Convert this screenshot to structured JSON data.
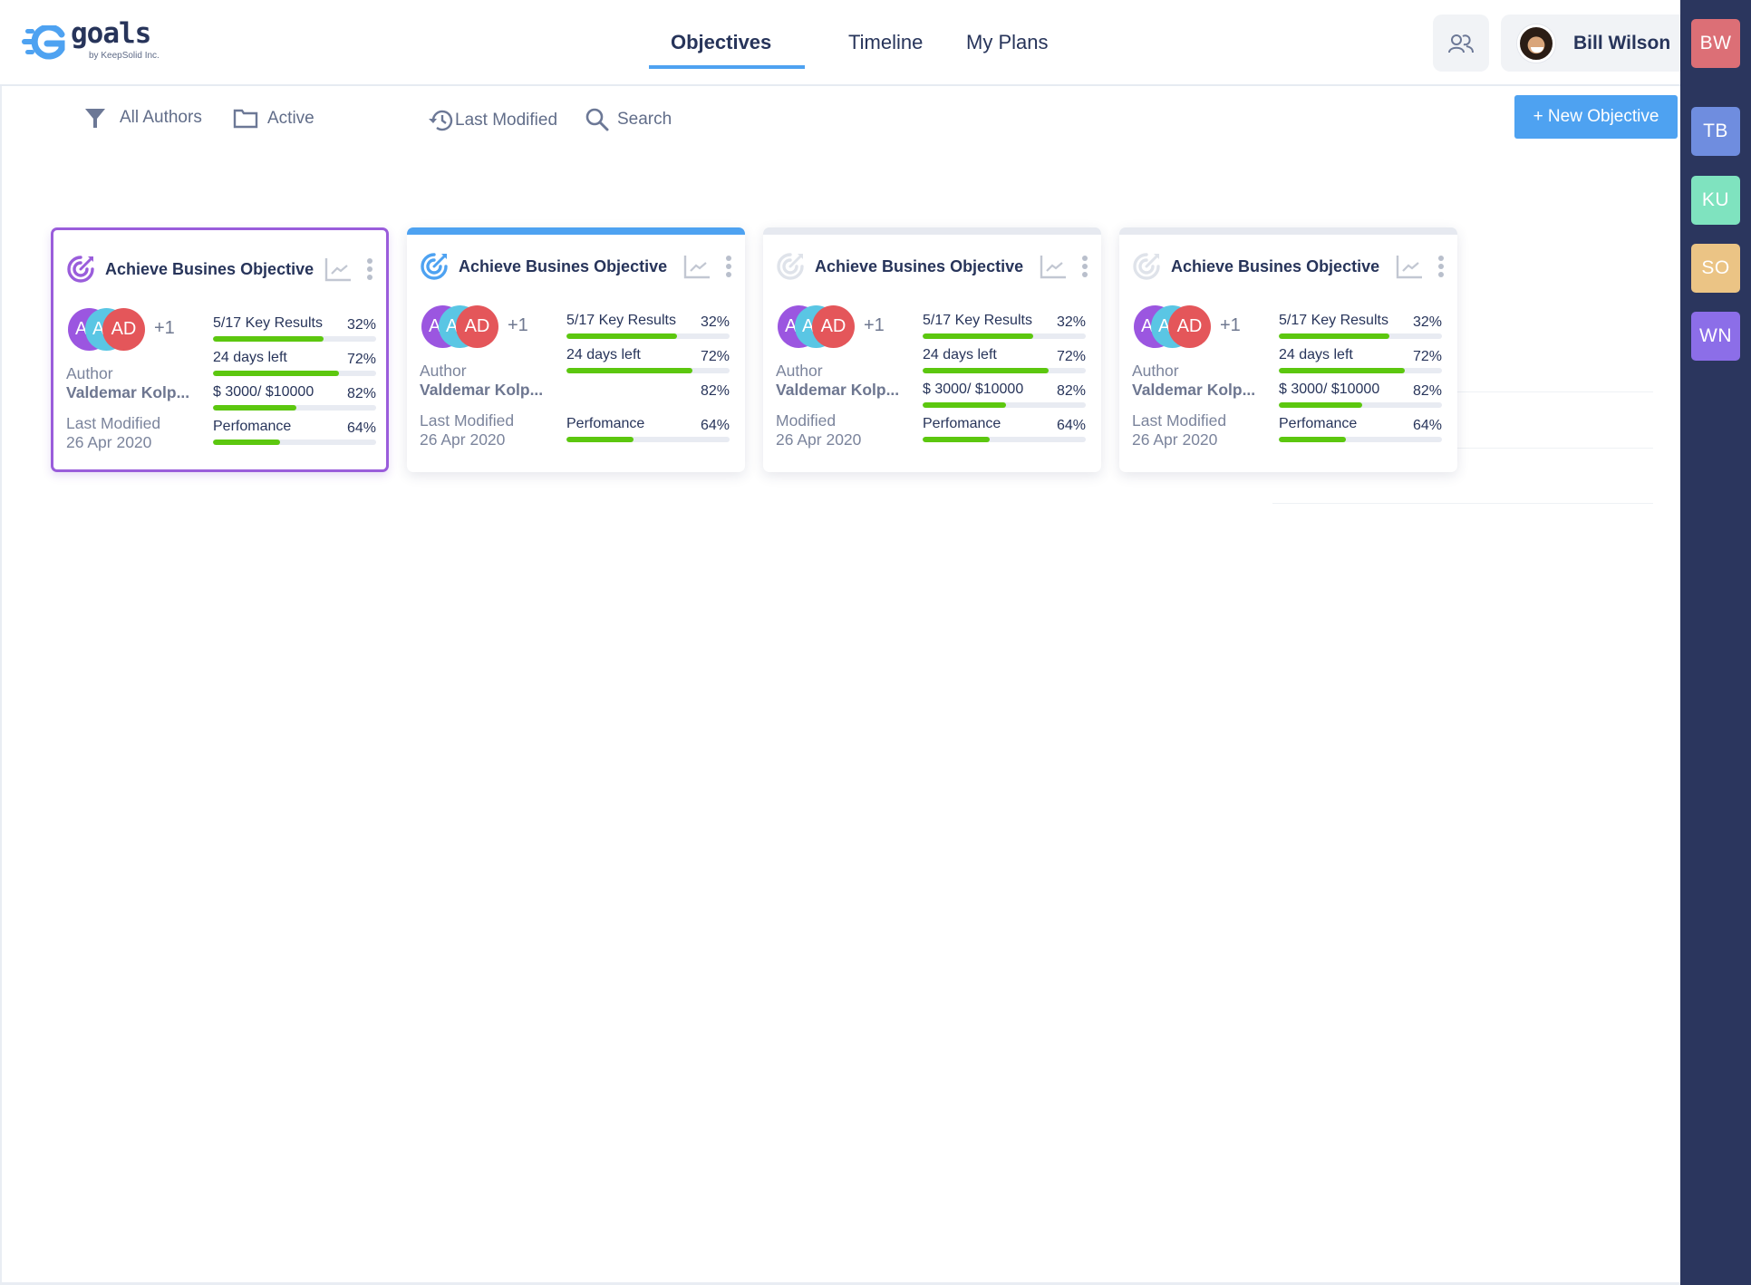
{
  "app": {
    "logo_text": "goals",
    "logo_subtitle": "by KeepSolid Inc.",
    "brand_color": "#4ea2f1"
  },
  "nav": {
    "tabs": [
      {
        "label": "Objectives",
        "active": true
      },
      {
        "label": "Timeline",
        "active": false
      },
      {
        "label": "My Plans",
        "active": false
      }
    ]
  },
  "user": {
    "name": "Bill Wilson",
    "people_icon": "people-icon"
  },
  "rail": {
    "members": [
      {
        "initials": "BW",
        "color": "#dc6f76"
      },
      {
        "initials": "TB",
        "color": "#6f8ddf"
      },
      {
        "initials": "KU",
        "color": "#7fe3bf"
      },
      {
        "initials": "SO",
        "color": "#ebc485"
      },
      {
        "initials": "WN",
        "color": "#8c6ee8"
      }
    ]
  },
  "filters": {
    "authors": {
      "label": "All Authors",
      "icon": "funnel-icon"
    },
    "status": {
      "label": "Active",
      "icon": "folder-icon"
    },
    "sort": {
      "label": "Last Modified",
      "icon": "history-icon"
    },
    "search": {
      "label": "Search",
      "icon": "search-icon"
    }
  },
  "toolbar": {
    "new_objective_label": "+ New Objective"
  },
  "cards": [
    {
      "title": "Achieve Busines Objective",
      "accent": "#9a5ddb",
      "icon_color": "#9a5ddb",
      "selected": true,
      "avatars": [
        "A",
        "A",
        "AD"
      ],
      "extra_count": "+1",
      "author_label": "Author",
      "author_name": "Valdemar Kolp...",
      "modified_label": "Last Modified",
      "modified_date": "26 Apr 2020",
      "metrics": [
        {
          "label": "5/17 Key Results",
          "percent": "32%",
          "bar_fill": 0.68,
          "show_bar": true
        },
        {
          "label": "24 days left",
          "percent": "72%",
          "bar_fill": 0.77,
          "show_bar": true
        },
        {
          "label": "$ 3000/ $10000",
          "percent": "82%",
          "bar_fill": 0.51,
          "show_bar": true
        },
        {
          "label": "Perfomance",
          "percent": "64%",
          "bar_fill": 0.41,
          "show_bar": true
        }
      ]
    },
    {
      "title": "Achieve Busines Objective",
      "accent": "#4ea2f1",
      "icon_color": "#4ea2f1",
      "selected": false,
      "avatars": [
        "A",
        "A",
        "AD"
      ],
      "extra_count": "+1",
      "author_label": "Author",
      "author_name": "Valdemar Kolp...",
      "modified_label": "Last Modified",
      "modified_date": "26 Apr 2020",
      "metrics": [
        {
          "label": "5/17 Key Results",
          "percent": "32%",
          "bar_fill": 0.68,
          "show_bar": true
        },
        {
          "label": "24 days left",
          "percent": "72%",
          "bar_fill": 0.77,
          "show_bar": true
        },
        {
          "label": "",
          "percent": "82%",
          "bar_fill": 0,
          "show_bar": false
        },
        {
          "label": "Perfomance",
          "percent": "64%",
          "bar_fill": 0.41,
          "show_bar": true
        }
      ]
    },
    {
      "title": "Achieve Busines Objective",
      "accent": "#e6e9f0",
      "icon_color": "#dfe3ea",
      "selected": false,
      "avatars": [
        "A",
        "A",
        "AD"
      ],
      "extra_count": "+1",
      "author_label": "Author",
      "author_name": "Valdemar Kolp...",
      "modified_label": "Modified",
      "modified_date": "26 Apr 2020",
      "metrics": [
        {
          "label": "5/17 Key Results",
          "percent": "32%",
          "bar_fill": 0.68,
          "show_bar": true
        },
        {
          "label": "24 days left",
          "percent": "72%",
          "bar_fill": 0.77,
          "show_bar": true
        },
        {
          "label": "$ 3000/ $10000",
          "percent": "82%",
          "bar_fill": 0.51,
          "show_bar": true
        },
        {
          "label": "Perfomance",
          "percent": "64%",
          "bar_fill": 0.41,
          "show_bar": true
        }
      ]
    },
    {
      "title": "Achieve Busines Objective",
      "accent": "#e6e9f0",
      "icon_color": "#dfe3ea",
      "selected": false,
      "avatars": [
        "A",
        "A",
        "AD"
      ],
      "extra_count": "+1",
      "author_label": "Author",
      "author_name": "Valdemar Kolp...",
      "modified_label": "Last Modified",
      "modified_date": "26 Apr 2020",
      "metrics": [
        {
          "label": "5/17 Key Results",
          "percent": "32%",
          "bar_fill": 0.68,
          "show_bar": true
        },
        {
          "label": "24 days left",
          "percent": "72%",
          "bar_fill": 0.77,
          "show_bar": true
        },
        {
          "label": "$ 3000/ $10000",
          "percent": "82%",
          "bar_fill": 0.51,
          "show_bar": true
        },
        {
          "label": "Perfomance",
          "percent": "64%",
          "bar_fill": 0.41,
          "show_bar": true
        }
      ]
    }
  ]
}
